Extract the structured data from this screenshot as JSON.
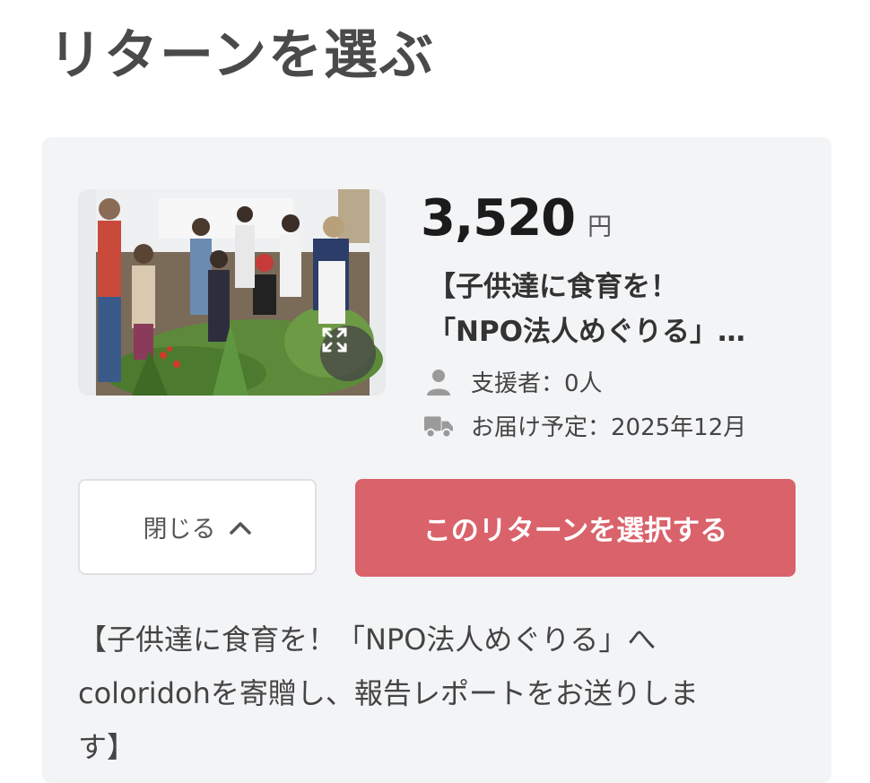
{
  "page": {
    "title": "リターンを選ぶ"
  },
  "reward": {
    "image_alt": "子供達が畑で野菜を手に取る食育活動の写真",
    "price": "3,520",
    "currency": "円",
    "title_lines": [
      "【子供達に食育を！",
      "「NPO法人めぐりる」…"
    ],
    "supporters": "支援者：0人",
    "delivery": "お届け予定：2025年12月",
    "close_label": "閉じる",
    "select_label": "このリターンを選択する",
    "description_lines": [
      "【子供達に食育を！「NPO法人めぐりる」へ",
      "coloridohを寄贈し、報告レポートをお送りしま",
      "す】"
    ]
  },
  "icons": {
    "supporter": "person-icon",
    "delivery": "truck-icon",
    "expand": "expand-icon",
    "close_chevron": "chevron-up-icon"
  },
  "colors": {
    "primary_button": "#d9626b",
    "card_background": "#f3f4f6",
    "title_text": "#4a4a4a"
  }
}
